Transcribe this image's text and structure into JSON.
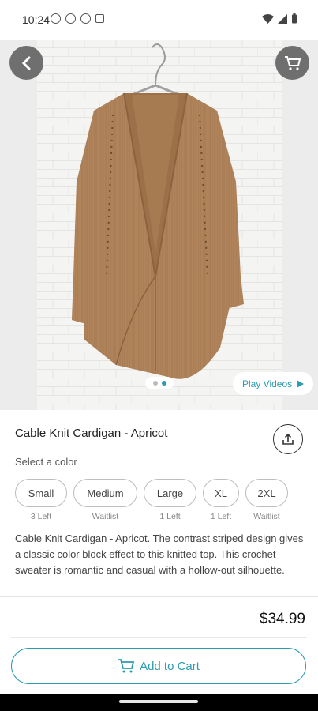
{
  "status_bar": {
    "time": "10:24"
  },
  "hero": {
    "play_videos_label": "Play Videos",
    "image_count": 2,
    "active_image": 2
  },
  "product": {
    "title": "Cable Knit Cardigan - Apricot",
    "select_color_label": "Select a color",
    "sizes": [
      {
        "label": "Small",
        "availability": "3 Left"
      },
      {
        "label": "Medium",
        "availability": "Waitlist"
      },
      {
        "label": "Large",
        "availability": "1 Left"
      },
      {
        "label": "XL",
        "availability": "1 Left"
      },
      {
        "label": "2XL",
        "availability": "Waitlist"
      }
    ],
    "description": "Cable Knit Cardigan - Apricot. The contrast striped design gives a classic color block effect to this knitted top. This crochet sweater is romantic and casual with a hollow-out silhouette.",
    "price": "$34.99"
  },
  "actions": {
    "add_to_cart_label": "Add to Cart"
  },
  "colors": {
    "accent": "#2a9bb0",
    "cardigan": "#b0835a"
  }
}
